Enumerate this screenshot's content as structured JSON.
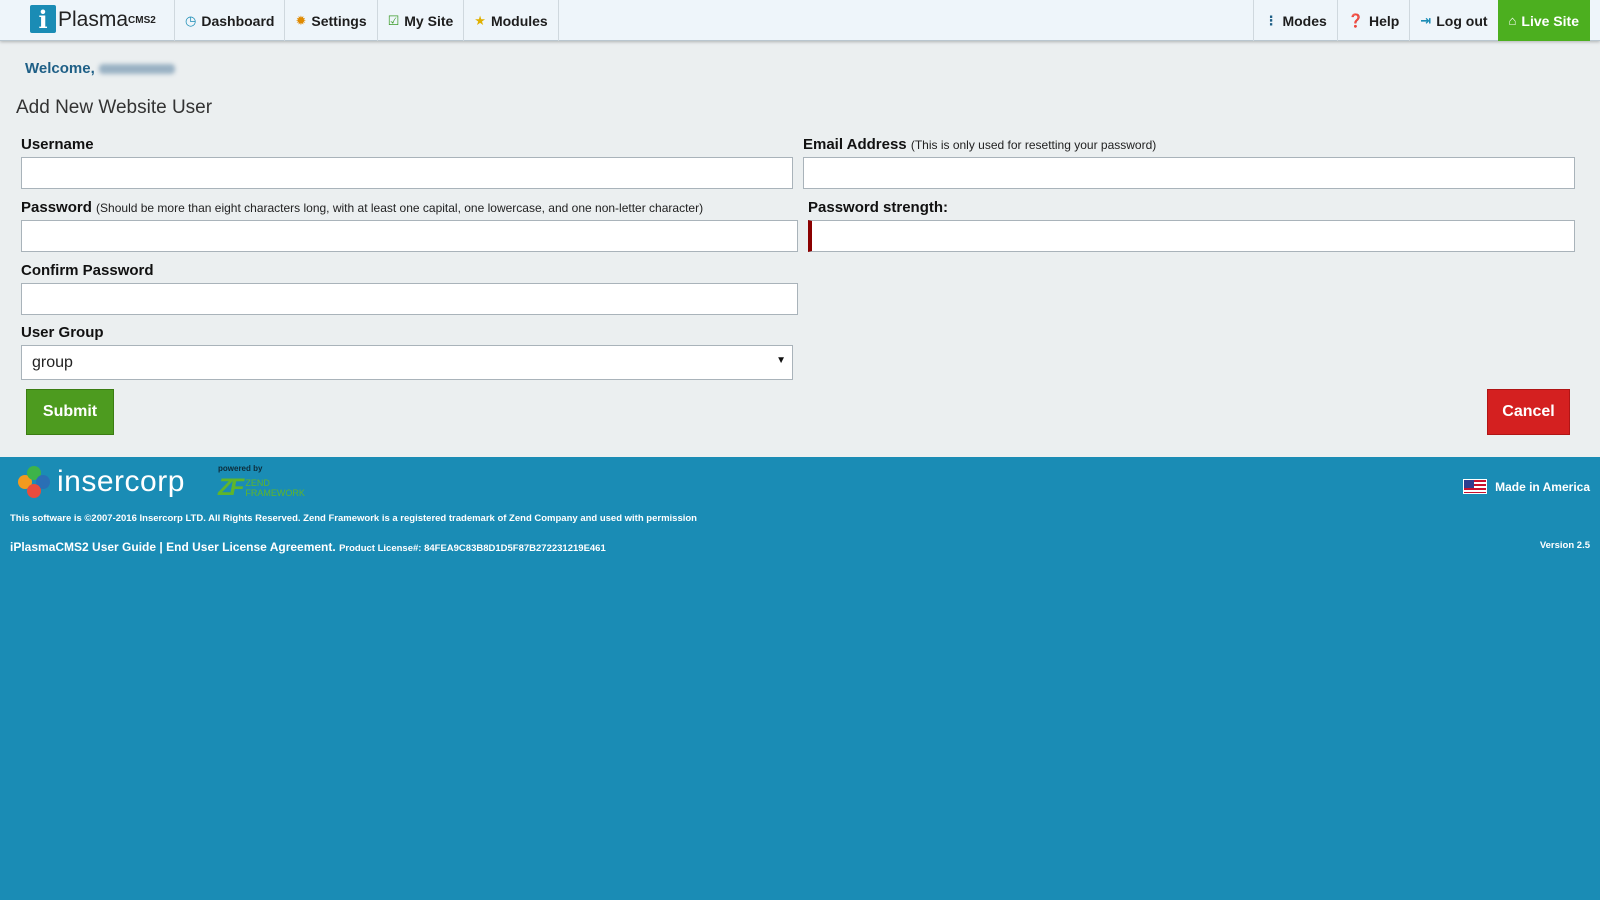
{
  "app": {
    "logo_name": "Plasma",
    "logo_sup": "CMS2"
  },
  "nav": {
    "left": [
      {
        "label": "Dashboard",
        "icon": "dashboard-icon"
      },
      {
        "label": "Settings",
        "icon": "gear-icon"
      },
      {
        "label": "My Site",
        "icon": "edit-icon"
      },
      {
        "label": "Modules",
        "icon": "star-icon"
      }
    ],
    "right": [
      {
        "label": "Modes",
        "icon": "vertical-dots-icon"
      },
      {
        "label": "Help",
        "icon": "question-icon"
      },
      {
        "label": "Log out",
        "icon": "logout-icon"
      },
      {
        "label": "Live Site",
        "icon": "home-icon"
      }
    ]
  },
  "welcome": {
    "label": "Welcome,"
  },
  "page_title": "Add New Website User",
  "form": {
    "username": {
      "label": "Username",
      "value": ""
    },
    "email": {
      "label": "Email Address",
      "hint": "(This is only used for resetting your password)",
      "value": ""
    },
    "password": {
      "label": "Password",
      "hint": "(Should be more than eight characters long, with at least one capital, one lowercase, and one non-letter character)",
      "value": ""
    },
    "strength": {
      "label": "Password strength:"
    },
    "confirm": {
      "label": "Confirm Password",
      "value": ""
    },
    "group": {
      "label": "User Group",
      "selected": "group"
    },
    "submit_label": "Submit",
    "cancel_label": "Cancel"
  },
  "footer": {
    "brand": "insercorp",
    "powered_by": "powered by",
    "zf_line1": "ZEND",
    "zf_line2": "FRAMEWORK",
    "made_in": "Made in America",
    "copyright": "This software is ©2007-2016 Insercorp LTD. All Rights Reserved. Zend Framework is a registered trademark of Zend Company and used with permission",
    "user_guide": "iPlasmaCMS2 User Guide",
    "separator": "|",
    "eula": "End User License Agreement.",
    "license": "Product License#: 84FEA9C83B8D1D5F87B272231219E461",
    "version": "Version 2.5"
  },
  "colors": {
    "accent": "#1a8cb5",
    "live_site": "#4caf1f",
    "submit": "#4d9b1f",
    "cancel": "#d42020",
    "strength_bar": "#8b0000"
  }
}
